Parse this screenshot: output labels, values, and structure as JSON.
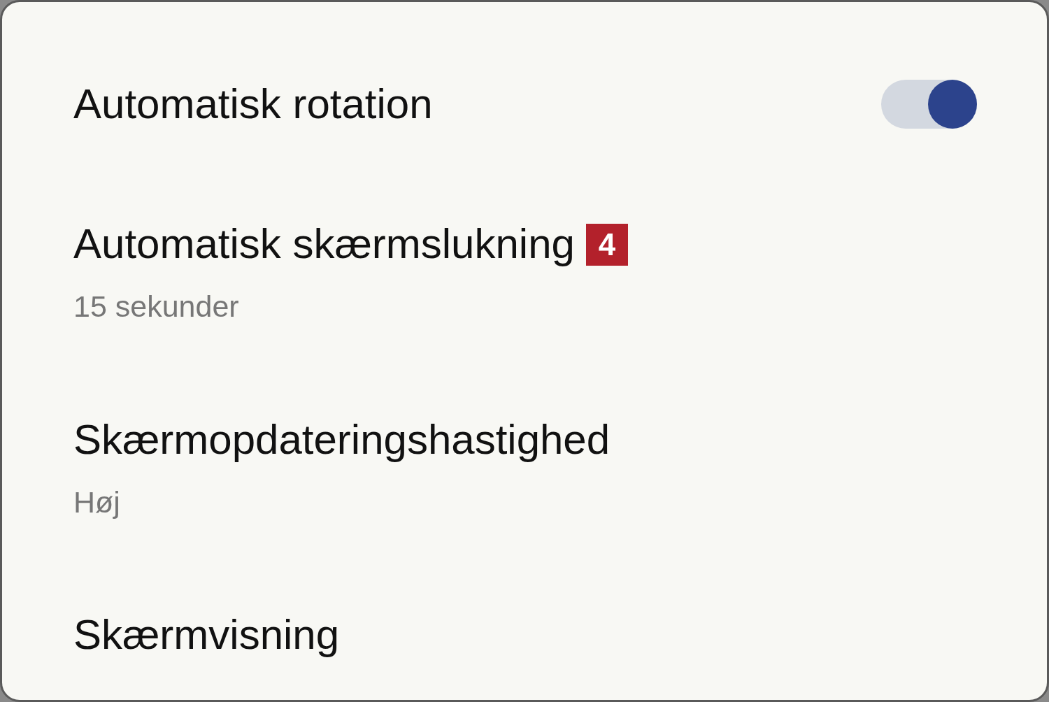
{
  "items": [
    {
      "kind": "toggle",
      "title": "Automatisk rotation",
      "on": true
    },
    {
      "kind": "value",
      "title": "Automatisk skærmslukning",
      "badge": "4",
      "value": "15 sekunder"
    },
    {
      "kind": "value",
      "title": "Skærmopdateringshastighed",
      "value": "Høj"
    },
    {
      "kind": "link",
      "title": "Skærmvisning"
    }
  ]
}
